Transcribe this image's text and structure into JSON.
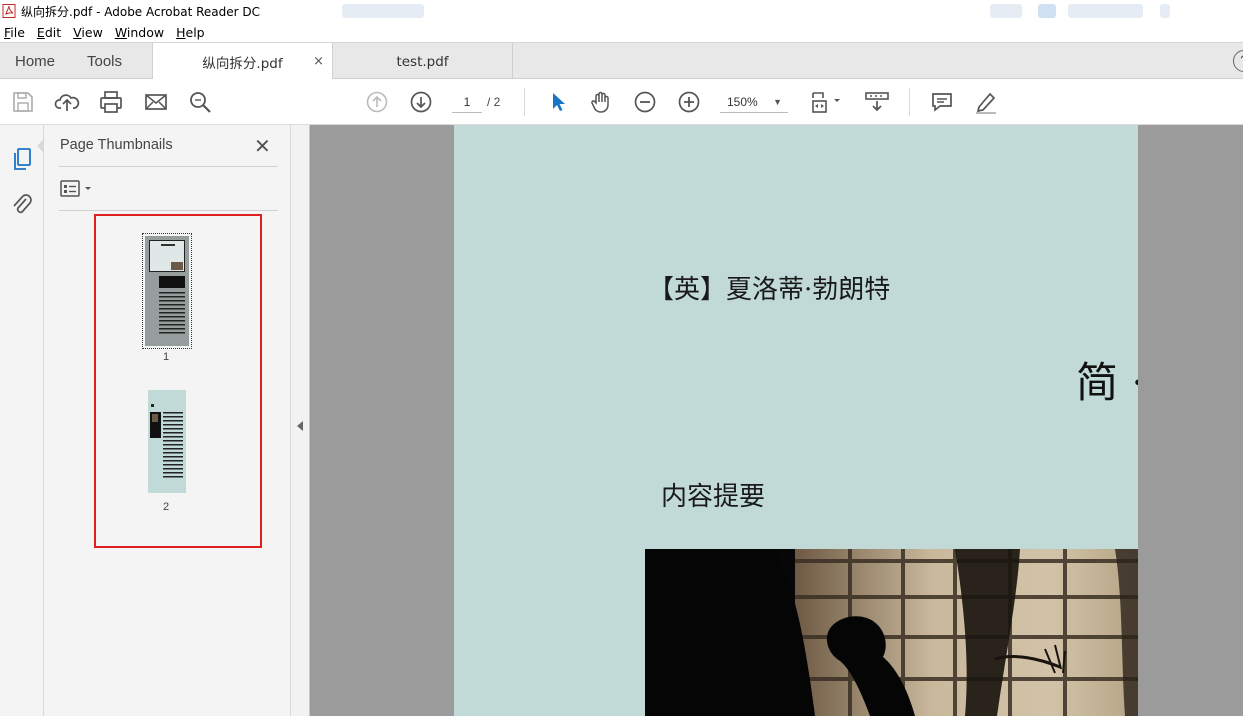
{
  "window": {
    "title": "纵向拆分.pdf - Adobe Acrobat Reader DC"
  },
  "menu": {
    "items": [
      {
        "first": "F",
        "rest": "ile"
      },
      {
        "first": "E",
        "rest": "dit"
      },
      {
        "first": "V",
        "rest": "iew"
      },
      {
        "first": "W",
        "rest": "indow"
      },
      {
        "first": "H",
        "rest": "elp"
      }
    ]
  },
  "tabs": {
    "home": "Home",
    "tools": "Tools",
    "documents": [
      {
        "label": "纵向拆分.pdf",
        "close": "×"
      },
      {
        "label": "test.pdf"
      }
    ],
    "help": "?"
  },
  "toolbar": {
    "page_current": "1",
    "page_total": "/ 2",
    "zoom": "150%",
    "zoom_caret": "▼"
  },
  "panel": {
    "title": "Page Thumbnails",
    "close": "✕",
    "thumbnails": [
      {
        "number": "1"
      },
      {
        "number": "2"
      }
    ]
  },
  "document": {
    "author_line": "【英】夏洛蒂·勃朗特",
    "big_char": "简 ·",
    "section_heading": "内容提要"
  },
  "colors": {
    "page_bg": "#c1dad8",
    "viewer_bg": "#9b9b9b",
    "highlight": "#e02020",
    "accent_blue": "#1a73c9"
  }
}
